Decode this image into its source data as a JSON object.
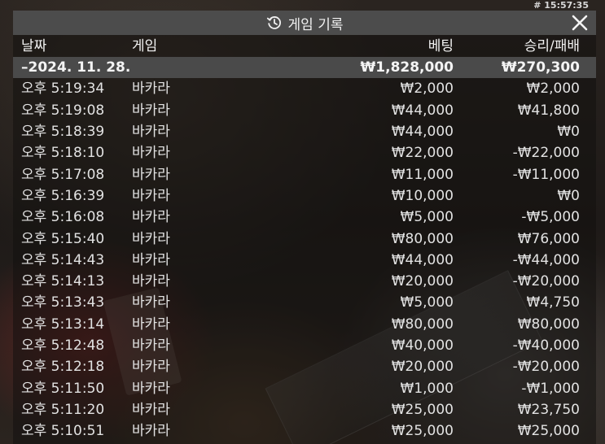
{
  "clock": "# 15:57:35",
  "dialog": {
    "title": "게임 기록",
    "title_icon": "history-icon",
    "close_icon": "close-icon"
  },
  "columns": {
    "date": "날짜",
    "game": "게임",
    "bet": "베팅",
    "result": "승리/패배"
  },
  "group": {
    "date_label": "–2024. 11. 28.",
    "bet_total": "₩1,828,000",
    "result_total": "₩270,300"
  },
  "rows": [
    {
      "time": "오후 5:19:34",
      "game": "바카라",
      "bet": "₩2,000",
      "result": "₩2,000"
    },
    {
      "time": "오후 5:19:08",
      "game": "바카라",
      "bet": "₩44,000",
      "result": "₩41,800"
    },
    {
      "time": "오후 5:18:39",
      "game": "바카라",
      "bet": "₩44,000",
      "result": "₩0"
    },
    {
      "time": "오후 5:18:10",
      "game": "바카라",
      "bet": "₩22,000",
      "result": "-₩22,000"
    },
    {
      "time": "오후 5:17:08",
      "game": "바카라",
      "bet": "₩11,000",
      "result": "-₩11,000"
    },
    {
      "time": "오후 5:16:39",
      "game": "바카라",
      "bet": "₩10,000",
      "result": "₩0"
    },
    {
      "time": "오후 5:16:08",
      "game": "바카라",
      "bet": "₩5,000",
      "result": "-₩5,000"
    },
    {
      "time": "오후 5:15:40",
      "game": "바카라",
      "bet": "₩80,000",
      "result": "₩76,000"
    },
    {
      "time": "오후 5:14:43",
      "game": "바카라",
      "bet": "₩44,000",
      "result": "-₩44,000"
    },
    {
      "time": "오후 5:14:13",
      "game": "바카라",
      "bet": "₩20,000",
      "result": "-₩20,000"
    },
    {
      "time": "오후 5:13:43",
      "game": "바카라",
      "bet": "₩5,000",
      "result": "₩4,750"
    },
    {
      "time": "오후 5:13:14",
      "game": "바카라",
      "bet": "₩80,000",
      "result": "₩80,000"
    },
    {
      "time": "오후 5:12:48",
      "game": "바카라",
      "bet": "₩40,000",
      "result": "-₩40,000"
    },
    {
      "time": "오후 5:12:18",
      "game": "바카라",
      "bet": "₩20,000",
      "result": "-₩20,000"
    },
    {
      "time": "오후 5:11:50",
      "game": "바카라",
      "bet": "₩1,000",
      "result": "-₩1,000"
    },
    {
      "time": "오후 5:11:20",
      "game": "바카라",
      "bet": "₩25,000",
      "result": "₩23,750"
    },
    {
      "time": "오후 5:10:51",
      "game": "바카라",
      "bet": "₩25,000",
      "result": "₩25,000"
    }
  ]
}
